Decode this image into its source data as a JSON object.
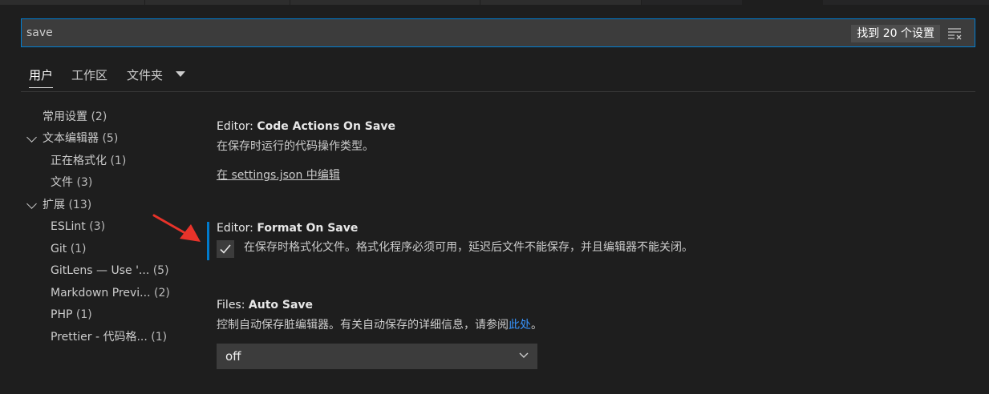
{
  "search": {
    "value": "save",
    "result_count": "找到 20 个设置"
  },
  "scopes": [
    {
      "label": "用户",
      "active": true
    },
    {
      "label": "工作区"
    },
    {
      "label": "文件夹"
    }
  ],
  "toc": [
    {
      "label": "常用设置",
      "count": "(2)",
      "level": 0
    },
    {
      "label": "文本编辑器",
      "count": "(5)",
      "level": 0,
      "expanded": true
    },
    {
      "label": "正在格式化",
      "count": "(1)",
      "level": 1
    },
    {
      "label": "文件",
      "count": "(3)",
      "level": 1
    },
    {
      "label": "扩展",
      "count": "(13)",
      "level": 0,
      "expanded": true
    },
    {
      "label": "ESLint",
      "count": "(3)",
      "level": 1
    },
    {
      "label": "Git",
      "count": "(1)",
      "level": 1
    },
    {
      "label": "GitLens — Use '...",
      "count": "(5)",
      "level": 1
    },
    {
      "label": "Markdown Previ...",
      "count": "(2)",
      "level": 1
    },
    {
      "label": "PHP",
      "count": "(1)",
      "level": 1
    },
    {
      "label": "Prettier - 代码格...",
      "count": "(1)",
      "level": 1
    }
  ],
  "settings": {
    "code_actions": {
      "category": "Editor: ",
      "name": "Code Actions On Save",
      "description": "在保存时运行的代码操作类型。",
      "link": "在 settings.json 中编辑"
    },
    "format_on_save": {
      "category": "Editor: ",
      "name": "Format On Save",
      "checked": true,
      "description": "在保存时格式化文件。格式化程序必须可用，延迟后文件不能保存，并且编辑器不能关闭。"
    },
    "auto_save": {
      "category": "Files: ",
      "name": "Auto Save",
      "description_prefix": "控制自动保存脏编辑器。有关自动保存的详细信息，请参阅",
      "link": "此处",
      "description_suffix": "。",
      "value": "off"
    }
  },
  "colors": {
    "background": "#1e1e1e",
    "focus": "#007acc",
    "link": "#3794ff",
    "annotation_arrow": "#e8332a"
  }
}
